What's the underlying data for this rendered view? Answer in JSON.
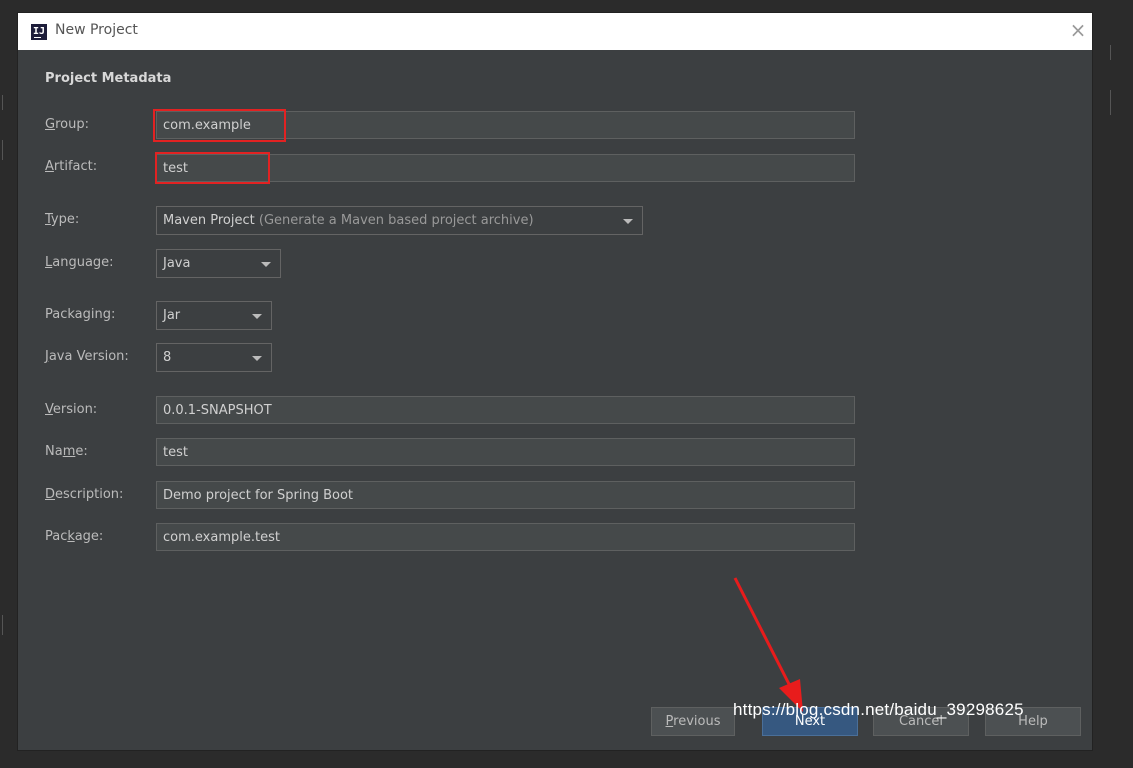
{
  "window": {
    "title": "New Project",
    "app_icon_text": "IJ"
  },
  "section_title": "Project Metadata",
  "fields": {
    "group": {
      "label_pre": "",
      "label_mn": "G",
      "label_post": "roup:",
      "value": "com.example"
    },
    "artifact": {
      "label_pre": "",
      "label_mn": "A",
      "label_post": "rtifact:",
      "value": "test"
    },
    "type": {
      "label_pre": "",
      "label_mn": "T",
      "label_post": "ype:",
      "value": "Maven Project",
      "hint": "(Generate a Maven based project archive)"
    },
    "language": {
      "label_pre": "",
      "label_mn": "L",
      "label_post": "anguage:",
      "value": "Java"
    },
    "packaging": {
      "label": "Packaging:",
      "value": "Jar"
    },
    "java_version": {
      "label_pre": "",
      "label_mn": "J",
      "label_post": "ava Version:",
      "value": "8"
    },
    "version": {
      "label_pre": "",
      "label_mn": "V",
      "label_post": "ersion:",
      "value": "0.0.1-SNAPSHOT"
    },
    "name": {
      "label_pre": "Na",
      "label_mn": "m",
      "label_post": "e:",
      "value": "test"
    },
    "description": {
      "label_pre": "",
      "label_mn": "D",
      "label_post": "escription:",
      "value": "Demo project for Spring Boot"
    },
    "package": {
      "label_pre": "Pac",
      "label_mn": "k",
      "label_post": "age:",
      "value": "com.example.test"
    }
  },
  "buttons": {
    "previous": {
      "mn": "P",
      "rest": "revious"
    },
    "next": "Next",
    "cancel": "Cancel",
    "help": "Help"
  },
  "watermark": "https://blog.csdn.net/baidu_39298625",
  "colors": {
    "highlight": "#e22222",
    "dialog_bg": "#3c3f41",
    "primary_button": "#365880"
  }
}
